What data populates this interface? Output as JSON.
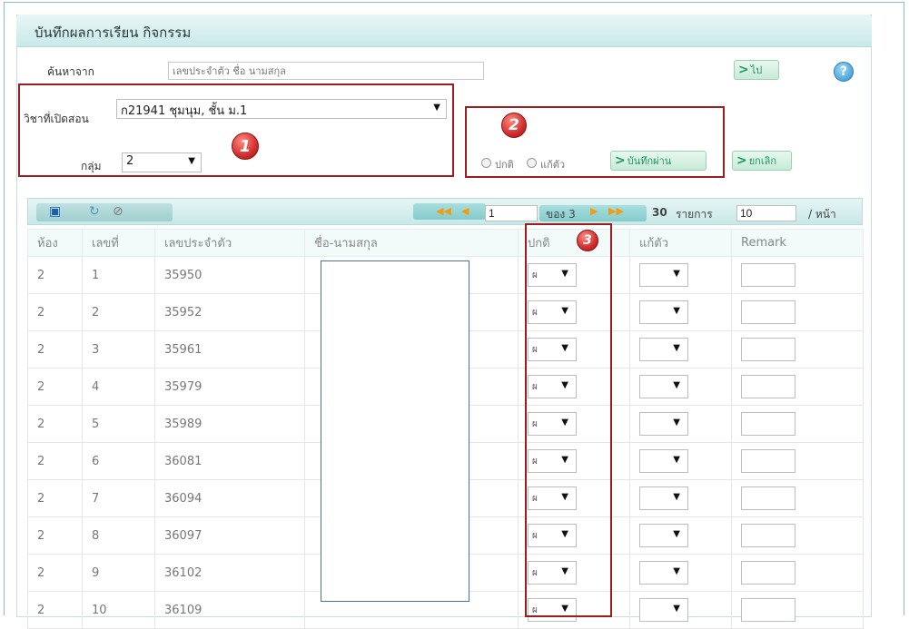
{
  "title": "บันทึกผลการเรียน กิจกรรม",
  "search": {
    "label": "ค้นหาจาก",
    "placeholder": "เลขประจำตัว ชื่อ นามสกุล",
    "go_label": "ไป"
  },
  "subject": {
    "label": "วิชาที่เปิดสอน",
    "value": "ก21941 ชุมนุม, ชั้น ม.1"
  },
  "group": {
    "label": "กลุ่ม",
    "value": "2"
  },
  "mode": {
    "normal_label": "ปกติ",
    "fix_label": "แก้ตัว",
    "save_label": "บันทึกผ่าน",
    "cancel_label": "ยกเลิก"
  },
  "badges": [
    "1",
    "2",
    "3"
  ],
  "pager": {
    "page": "1",
    "of_label": "ของ 3",
    "total": "30",
    "items_label": "รายการ",
    "per_page": "10",
    "per_page_label": "/ หน้า"
  },
  "table": {
    "headers": [
      "ห้อง",
      "เลขที่",
      "เลขประจำตัว",
      "ชื่อ-นามสกุล",
      "ปกติ",
      "แก้ตัว",
      "Remark"
    ],
    "rows": [
      {
        "room": "2",
        "no": "1",
        "id": "35950",
        "normal": "ผ"
      },
      {
        "room": "2",
        "no": "2",
        "id": "35952",
        "normal": "ผ"
      },
      {
        "room": "2",
        "no": "3",
        "id": "35961",
        "normal": "ผ"
      },
      {
        "room": "2",
        "no": "4",
        "id": "35979",
        "normal": "ผ"
      },
      {
        "room": "2",
        "no": "5",
        "id": "35989",
        "normal": "ผ"
      },
      {
        "room": "2",
        "no": "6",
        "id": "36081",
        "normal": "ผ"
      },
      {
        "room": "2",
        "no": "7",
        "id": "36094",
        "normal": "ผ"
      },
      {
        "room": "2",
        "no": "8",
        "id": "36097",
        "normal": "ผ"
      },
      {
        "room": "2",
        "no": "9",
        "id": "36102",
        "normal": "ผ"
      },
      {
        "room": "2",
        "no": "10",
        "id": "36109",
        "normal": "ผ"
      }
    ]
  },
  "colors": {
    "accent_green": "#1d9a5e",
    "highlight_red": "#9b1d1d",
    "header_teal": "#c9e9e9"
  }
}
